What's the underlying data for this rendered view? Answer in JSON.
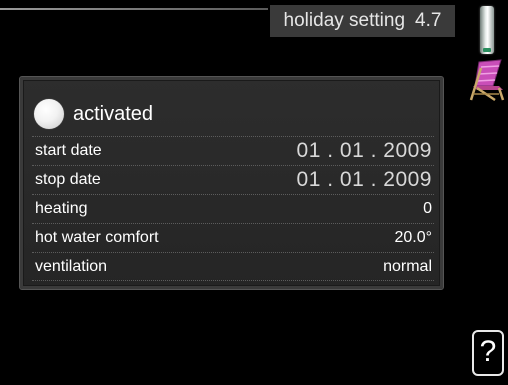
{
  "header": {
    "title": "holiday setting",
    "menu_number": "4.7"
  },
  "status": {
    "label": "activated",
    "selected": true
  },
  "settings": [
    {
      "label": "start date",
      "value": "01 . 01 . 2009"
    },
    {
      "label": "stop date",
      "value": "01 . 01 . 2009"
    },
    {
      "label": "heating",
      "value": "0"
    },
    {
      "label": "hot water comfort",
      "value": "20.0°"
    },
    {
      "label": "ventilation",
      "value": "normal"
    }
  ],
  "icons": {
    "menu_icon": "deck-chair-icon",
    "help_icon": "question-mark-icon",
    "help_symbol": "?"
  },
  "colors": {
    "background": "#000000",
    "title_bar": "#3a3a3a",
    "panel": "#2a2a2a",
    "scroll_accent": "#2a8f5f",
    "chair_icon": "#c04bb0"
  }
}
